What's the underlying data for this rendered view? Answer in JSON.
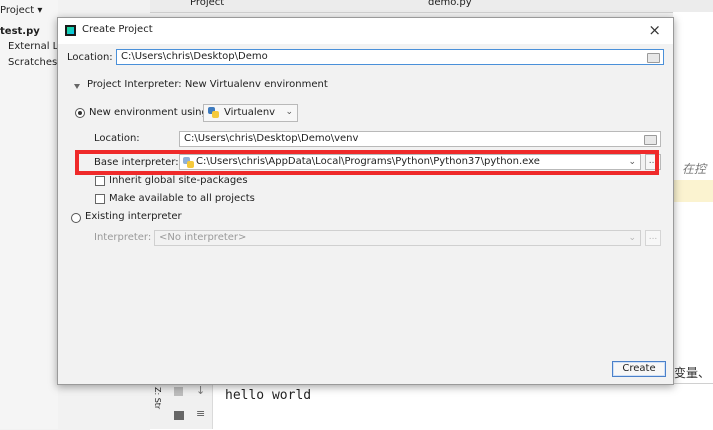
{
  "ide": {
    "project_menu": "Project",
    "project_tab": "Project",
    "editor_tab": "demo.py",
    "tree": [
      "test.py",
      "External Lib",
      "Scratches a"
    ],
    "sidebar_label": "Z: Str",
    "console_text": "hello world",
    "cjk_right_1": "在控",
    "cjk_right_2": "变量、"
  },
  "dialog": {
    "title": "Create Project",
    "close": "×",
    "location_label": "Location:",
    "location_value": "C:\\Users\\chris\\Desktop\\Demo",
    "section_title": "Project Interpreter: New Virtualenv environment",
    "new_env_label": "New environment using",
    "env_tool": "Virtualenv",
    "venv_location_label": "Location:",
    "venv_location_value": "C:\\Users\\chris\\Desktop\\Demo\\venv",
    "base_interpreter_label": "Base interpreter:",
    "base_interpreter_value": "C:\\Users\\chris\\AppData\\Local\\Programs\\Python\\Python37\\python.exe",
    "inherit_label": "Inherit global site-packages",
    "make_available_label": "Make available to all projects",
    "existing_label": "Existing interpreter",
    "interpreter_label": "Interpreter:",
    "interpreter_value": "<No interpreter>",
    "browse_label": "...",
    "create_label": "Create"
  },
  "colors": {
    "highlight": "#ef2a2a",
    "focus": "#4a90d9"
  }
}
